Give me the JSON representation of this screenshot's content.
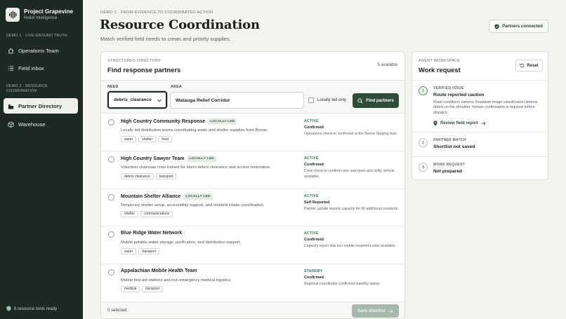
{
  "brand": {
    "title": "Project Grapevine",
    "subtitle": "Relief Intelligence"
  },
  "sidebar": {
    "section1": "DEMO 1 · LIVE GROUND TRUTH",
    "section2_line1": "DEMO 2 · RESOURCE",
    "section2_line2": "COORDINATION",
    "items": [
      {
        "label": "Operations Team",
        "icon": "home-icon"
      },
      {
        "label": "Field inbox",
        "icon": "list-icon"
      },
      {
        "label": "Partner Directory",
        "icon": "building-icon",
        "active": true
      },
      {
        "label": "Warehouse",
        "icon": "box-icon"
      }
    ],
    "status": "6 resource tools ready"
  },
  "header": {
    "eyebrow": "DEMO 2 · FROM EVIDENCE TO COORDINATED ACTION",
    "title": "Resource Coordination",
    "subtitle": "Match verified field needs to crews and priority supplies.",
    "badge": "Partners connected"
  },
  "directory": {
    "eyebrow": "STRUCTURED DIRECTORY",
    "title": "Find response partners",
    "count": "5 available",
    "need_label": "NEED",
    "need_value": "debris_clearance",
    "area_label": "AREA",
    "area_value": "Watauga Relief Corridor",
    "local_only_label": "Locally led only",
    "find_label": "Find partners",
    "selected": "0 selected",
    "save_label": "Save shortlist",
    "local_badge": "LOCALLY LED",
    "partners": [
      {
        "name": "High Country Community Response",
        "local": true,
        "desc": "Locally led distribution teams coordinating water and shelter supplies from Boone.",
        "tags": [
          "water",
          "shelter",
          "food"
        ],
        "state": "ACTIVE",
        "level": "Confirmed",
        "note": "Operations check-in confirmed at the Boone Staging Hub."
      },
      {
        "name": "High Country Sawyer Team",
        "local": true,
        "desc": "Volunteer chainsaw crew trained for storm debris clearance and access restoration.",
        "tags": [
          "debris clearance",
          "transport"
        ],
        "state": "ACTIVE",
        "level": "Confirmed",
        "note": "Crew check-in confirms one saw team and utility vehicle available."
      },
      {
        "name": "Mountain Shelter Alliance",
        "local": true,
        "desc": "Temporary shelter setup, accessibility support, and resident intake coordination.",
        "tags": [
          "shelter",
          "communications"
        ],
        "state": "ACTIVE",
        "level": "Self Reported",
        "note": "Partner update reports capacity for 60 additional residents."
      },
      {
        "name": "Blue Ridge Water Network",
        "local": false,
        "desc": "Mobile potable-water storage, purification, and distribution support.",
        "tags": [
          "water",
          "transport"
        ],
        "state": "ACTIVE",
        "level": "Confirmed",
        "note": "Capacity report lists two mobile treatment units available."
      },
      {
        "name": "Appalachian Mobile Health Team",
        "local": false,
        "desc": "Mobile first-aid stations and non-emergency medical logistics.",
        "tags": [
          "medical",
          "transport"
        ],
        "state": "STANDBY",
        "level": "Confirmed",
        "note": "Regional coordinator confirmed standby status."
      }
    ]
  },
  "agent": {
    "eyebrow": "AGENT WORKSPACE",
    "title": "Work request",
    "reset_label": "Reset",
    "steps": [
      {
        "num": "1",
        "label": "VERIFIED ISSUE",
        "title": "Route reported caution",
        "note": "Road conditions camera: Roadside image classification detects debris on the shoulder; human confirmation is required before dispatch.",
        "link": "Review field report"
      },
      {
        "num": "2",
        "label": "PARTNER MATCH",
        "title": "Shortlist not saved"
      },
      {
        "num": "3",
        "label": "WORK REQUEST",
        "title": "Not prepared"
      }
    ]
  },
  "colors": {
    "sidebar": "#1d2a23",
    "accent": "#2d4d39",
    "active_status": "#2f7a48",
    "save_disabled": "#a7b9ab"
  }
}
